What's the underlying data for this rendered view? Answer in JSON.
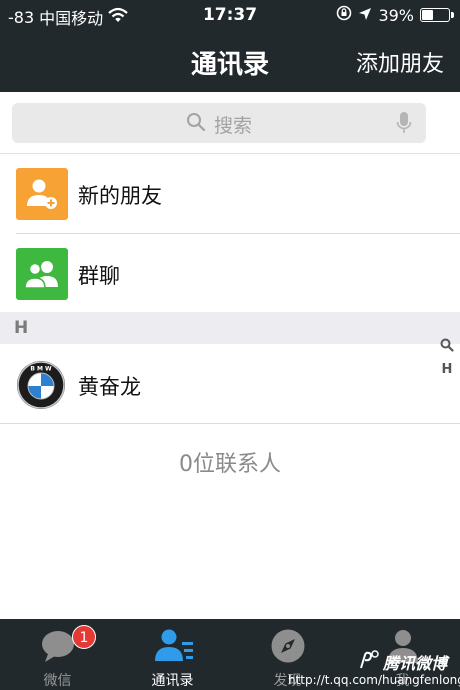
{
  "status_bar": {
    "signal": "-83",
    "carrier": "中国移动",
    "time": "17:37",
    "battery_percent": "39%",
    "battery_level": 0.39
  },
  "nav": {
    "title": "通讯录",
    "action_label": "添加朋友"
  },
  "search": {
    "placeholder": "搜索"
  },
  "rows": [
    {
      "label": "新的朋友",
      "icon": "new-friend-icon",
      "color": "#f6a234"
    },
    {
      "label": "群聊",
      "icon": "group-chat-icon",
      "color": "#3fb83f"
    }
  ],
  "section": {
    "header": "H"
  },
  "contacts": [
    {
      "name": "黄奋龙",
      "avatar": "bmw-logo-avatar"
    }
  ],
  "index_bar": {
    "letter": "H"
  },
  "contact_count": "0位联系人",
  "tabs": [
    {
      "label": "微信",
      "icon": "chat-bubble-icon",
      "badge": "1"
    },
    {
      "label": "通讯录",
      "icon": "contacts-icon",
      "active": true
    },
    {
      "label": "发现",
      "icon": "compass-icon"
    },
    {
      "label": "我",
      "icon": "person-icon"
    }
  ],
  "watermark": {
    "brand": "腾讯微博",
    "url": "http://t.qq.com/huangfenlong"
  },
  "colors": {
    "bar_background": "#22292c",
    "accent_blue": "#2f9bea",
    "badge_red": "#e53935"
  }
}
